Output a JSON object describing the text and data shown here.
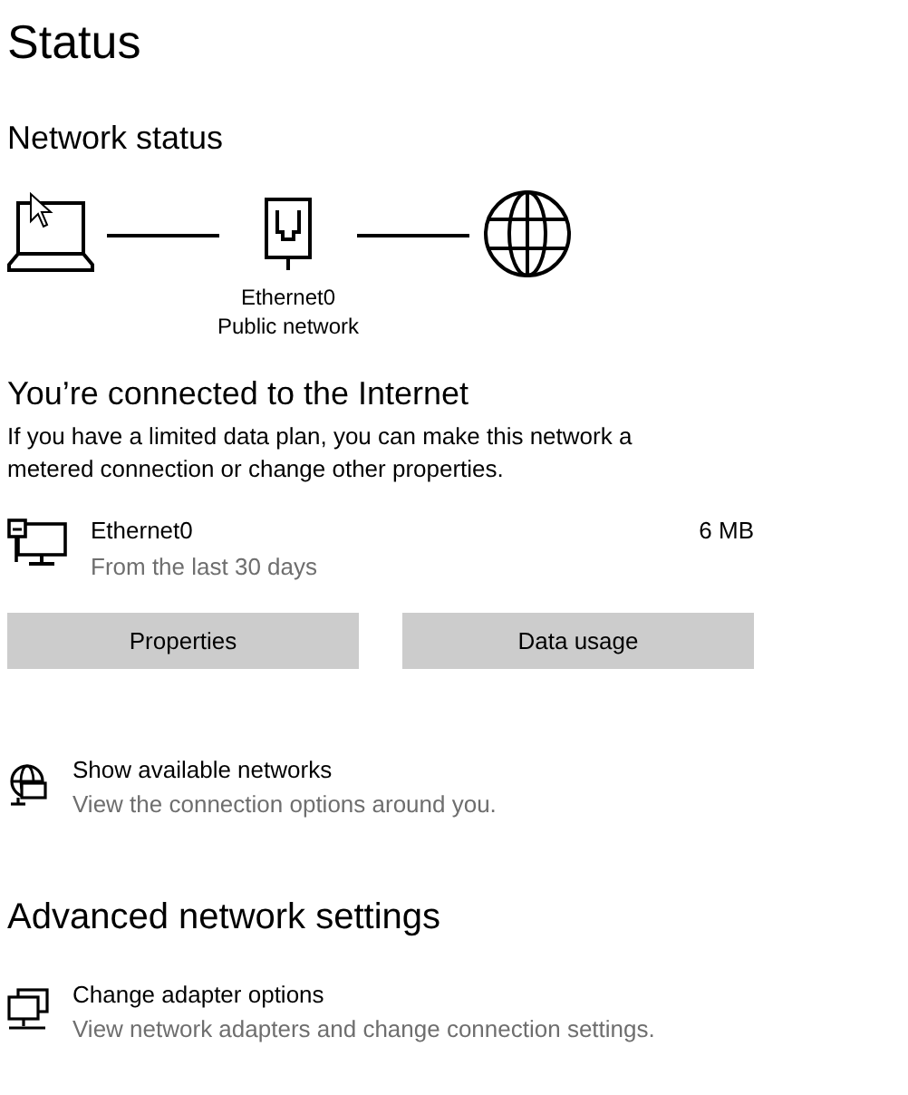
{
  "title": "Status",
  "network_status": {
    "heading": "Network status",
    "adapter_name": "Ethernet0",
    "network_type": "Public network"
  },
  "connection": {
    "heading": "You’re connected to the Internet",
    "description": "If you have a limited data plan, you can make this network a metered connection or change other properties."
  },
  "adapter_usage": {
    "name": "Ethernet0",
    "period": "From the last 30 days",
    "amount": "6 MB"
  },
  "buttons": [
    {
      "label": "Properties"
    },
    {
      "label": "Data usage"
    }
  ],
  "links": [
    {
      "kind": "networks",
      "title": "Show available networks",
      "subtitle": "View the connection options around you."
    }
  ],
  "advanced": {
    "heading": "Advanced network settings",
    "links": [
      {
        "kind": "adapter",
        "title": "Change adapter options",
        "subtitle": "View network adapters and change connection settings."
      }
    ]
  }
}
